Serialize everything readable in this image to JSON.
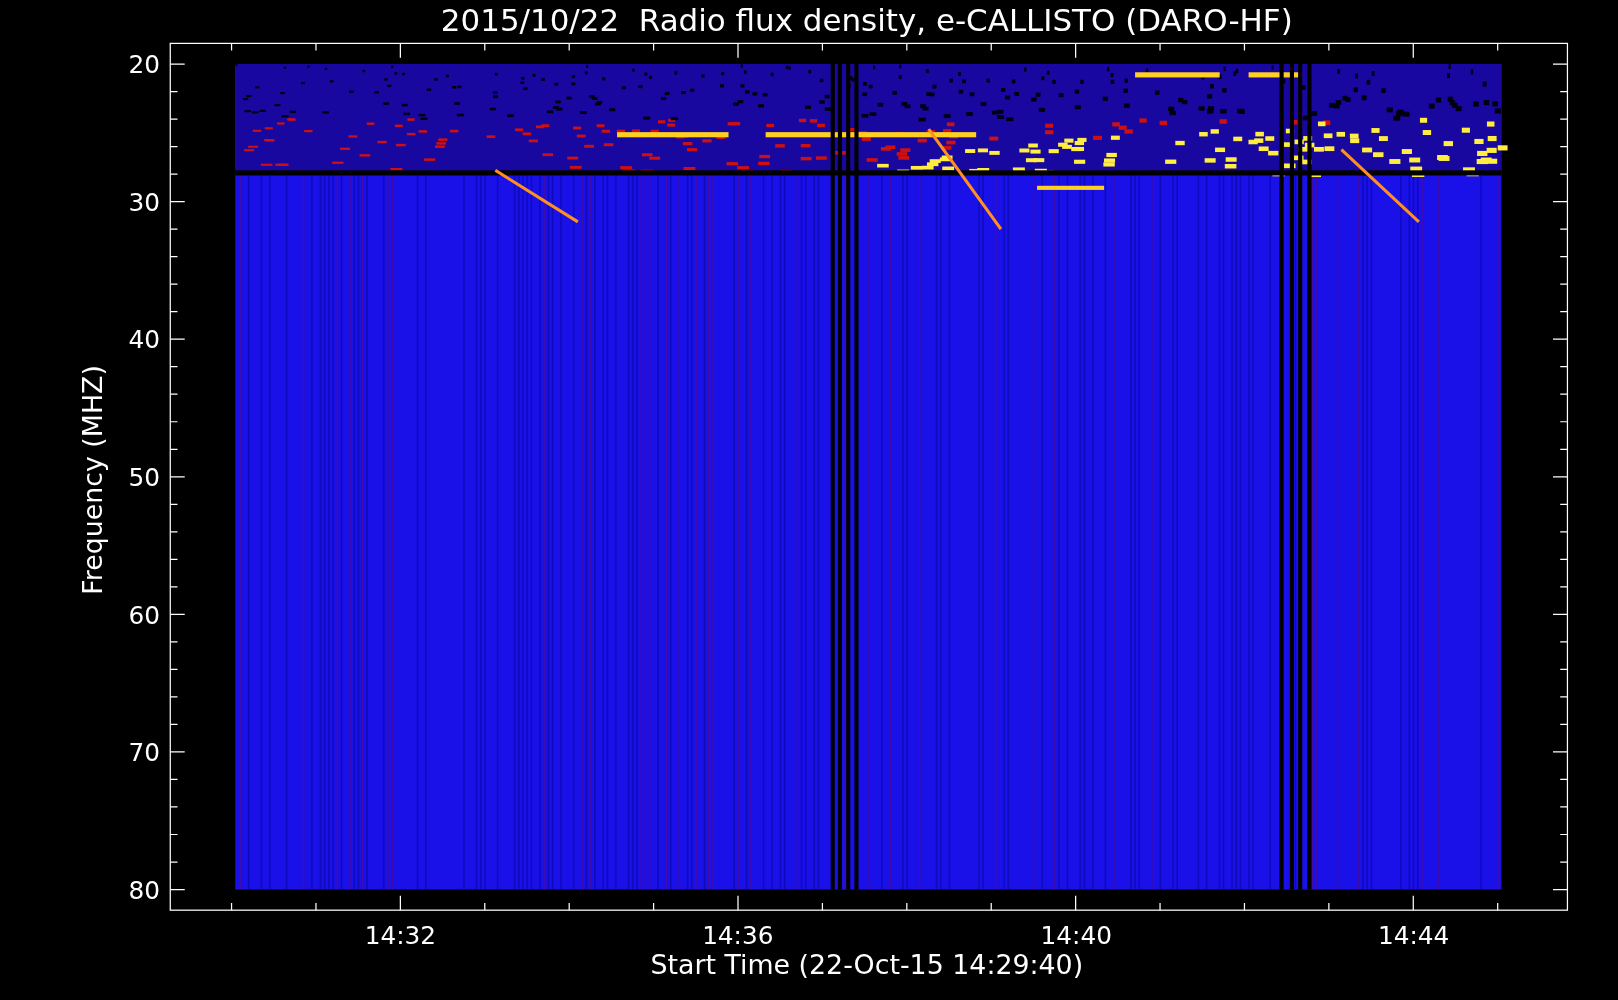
{
  "title": "2015/10/22  Radio flux density, e-CALLISTO (DARO-HF)",
  "y_axis": {
    "label": "Frequency (MHZ)",
    "ticks": [
      "20",
      "30",
      "40",
      "50",
      "60",
      "70",
      "80"
    ]
  },
  "x_axis": {
    "label": "Start Time (22-Oct-15 14:29:40)",
    "ticks": [
      "14:32",
      "14:36",
      "14:40",
      "14:44"
    ]
  }
}
